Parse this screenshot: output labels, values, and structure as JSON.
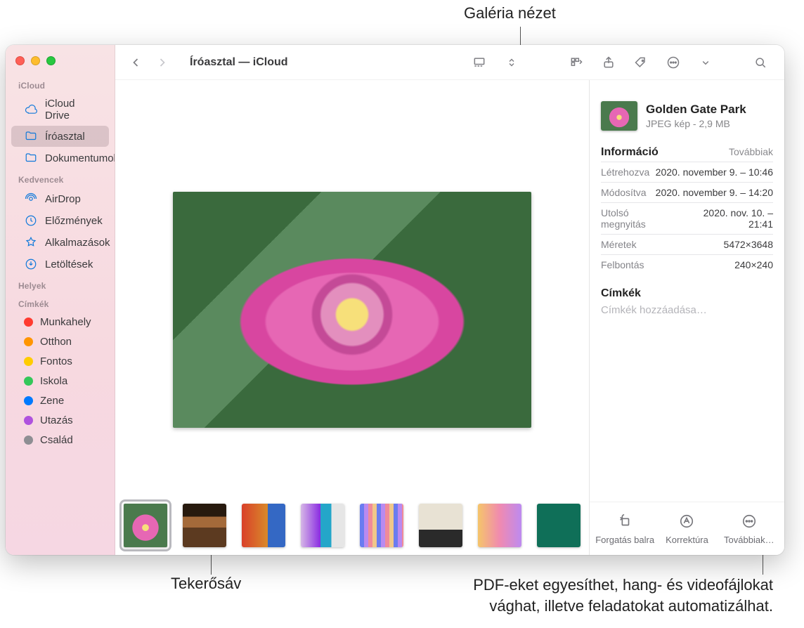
{
  "callouts": {
    "top": "Galéria nézet",
    "bottomLeft": "Tekerősáv",
    "bottomRight1": "PDF-eket egyesíthet, hang- és videofájlokat",
    "bottomRight2": "vághat, illetve feladatokat automatizálhat."
  },
  "toolbar": {
    "title": "Íróasztal — iCloud"
  },
  "sidebar": {
    "sections": {
      "icloud": "iCloud",
      "favorites": "Kedvencek",
      "locations": "Helyek",
      "tags": "Címkék"
    },
    "icloud": [
      {
        "label": "iCloud Drive"
      },
      {
        "label": "Íróasztal"
      },
      {
        "label": "Dokumentumok"
      }
    ],
    "favorites": [
      {
        "label": "AirDrop"
      },
      {
        "label": "Előzmények"
      },
      {
        "label": "Alkalmazások"
      },
      {
        "label": "Letöltések"
      }
    ],
    "tags": [
      {
        "label": "Munkahely",
        "color": "#ff3b30"
      },
      {
        "label": "Otthon",
        "color": "#ff9500"
      },
      {
        "label": "Fontos",
        "color": "#ffcc00"
      },
      {
        "label": "Iskola",
        "color": "#34c759"
      },
      {
        "label": "Zene",
        "color": "#007aff"
      },
      {
        "label": "Utazás",
        "color": "#af52de"
      },
      {
        "label": "Család",
        "color": "#8e8e93"
      }
    ]
  },
  "info": {
    "title": "Golden Gate Park",
    "subtitle": "JPEG kép - 2,9 MB",
    "sectionHeader": "Információ",
    "moreLabel": "Továbbiak",
    "rows": [
      {
        "k": "Létrehozva",
        "v": "2020. november 9. – 10:46"
      },
      {
        "k": "Módosítva",
        "v": "2020. november 9. – 14:20"
      },
      {
        "k": "Utolsó megnyitás",
        "v": "2020. nov. 10. – 21:41"
      },
      {
        "k": "Méretek",
        "v": "5472×3648"
      },
      {
        "k": "Felbontás",
        "v": "240×240"
      }
    ],
    "tagsHeader": "Címkék",
    "tagsPlaceholder": "Címkék hozzáadása…",
    "actions": {
      "rotate": "Forgatás balra",
      "markup": "Korrektúra",
      "more": "Továbbiak…"
    }
  }
}
